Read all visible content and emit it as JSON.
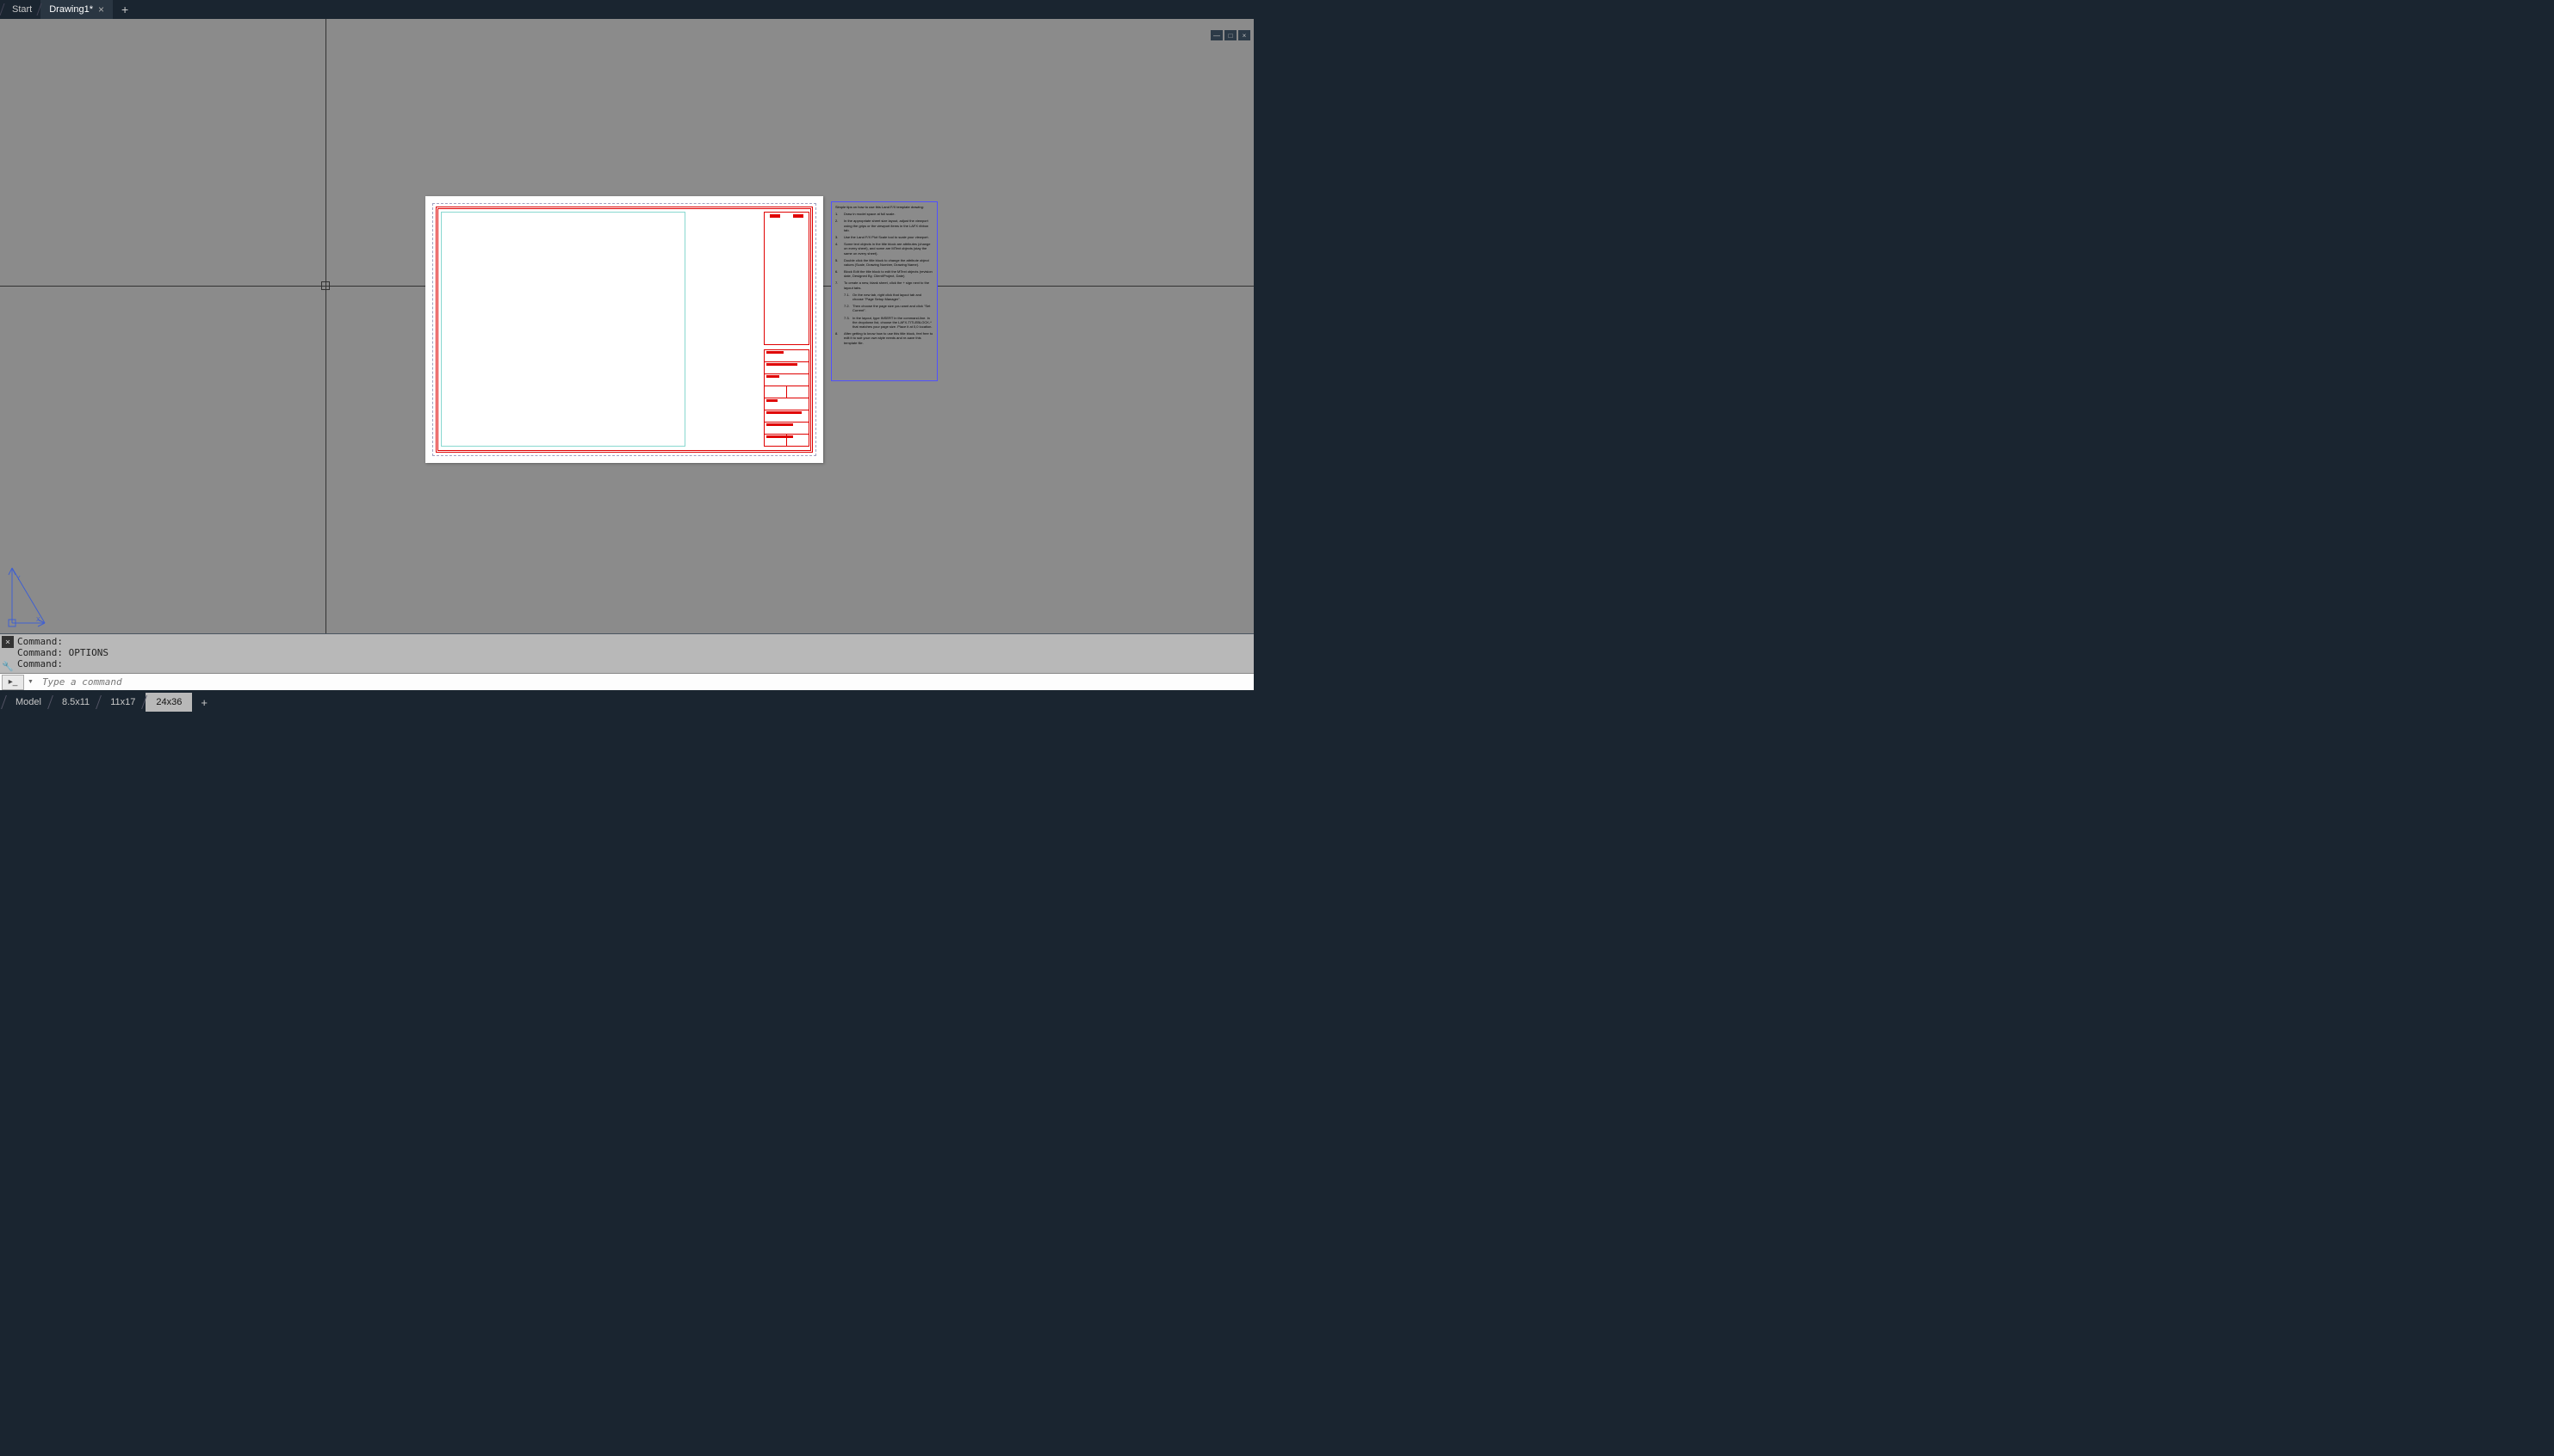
{
  "tabs": {
    "start": "Start",
    "drawing": "Drawing1*"
  },
  "command": {
    "line1": "Command:",
    "line2": "Command:   OPTIONS",
    "line3": "Command:",
    "placeholder": "Type a command"
  },
  "layouts": {
    "model": "Model",
    "l1": "8.5x11",
    "l2": "11x17",
    "l3": "24x36"
  },
  "tips": {
    "intro": "Simple tips on how to use this Land F/X template drawing:",
    "t1": "Draw in model space at full scale.",
    "t2": "In the appropriate sheet size layout, adjust the viewport using the grips or the viewport items in the LAFX ribbon tab.",
    "t3": "Use the Land F/X Plot Scale tool to scale your viewport.",
    "t4": "Some text objects in the title block are attributes (change on every sheet), and some are MText objects (stay the same on every sheet).",
    "t5": "Double click the title block to change the attribute object values (Scale, Drawing Number, Drawing Name).",
    "t6": "Block Edit the title block to edit the MText objects (revision date, Designed By, Client/Project, Date)",
    "t7": "To create a new, blank sheet, click the + sign next to the layout tabs.",
    "t71": "On the new tab, right click that layout tab and choose \"Page Setup Manager\".",
    "t72": "Then choose the page size you want and click \"Set Current\".",
    "t73": "In the layout, type INSERT in the command-line. In the dropdown list, choose the LAFX-TITLEBLOCK-* that matches your page size. Place it at 0,0 location.",
    "t8": "After getting to know how to use this title block, feel free to edit it to suit your own style needs and re-save this template file."
  }
}
